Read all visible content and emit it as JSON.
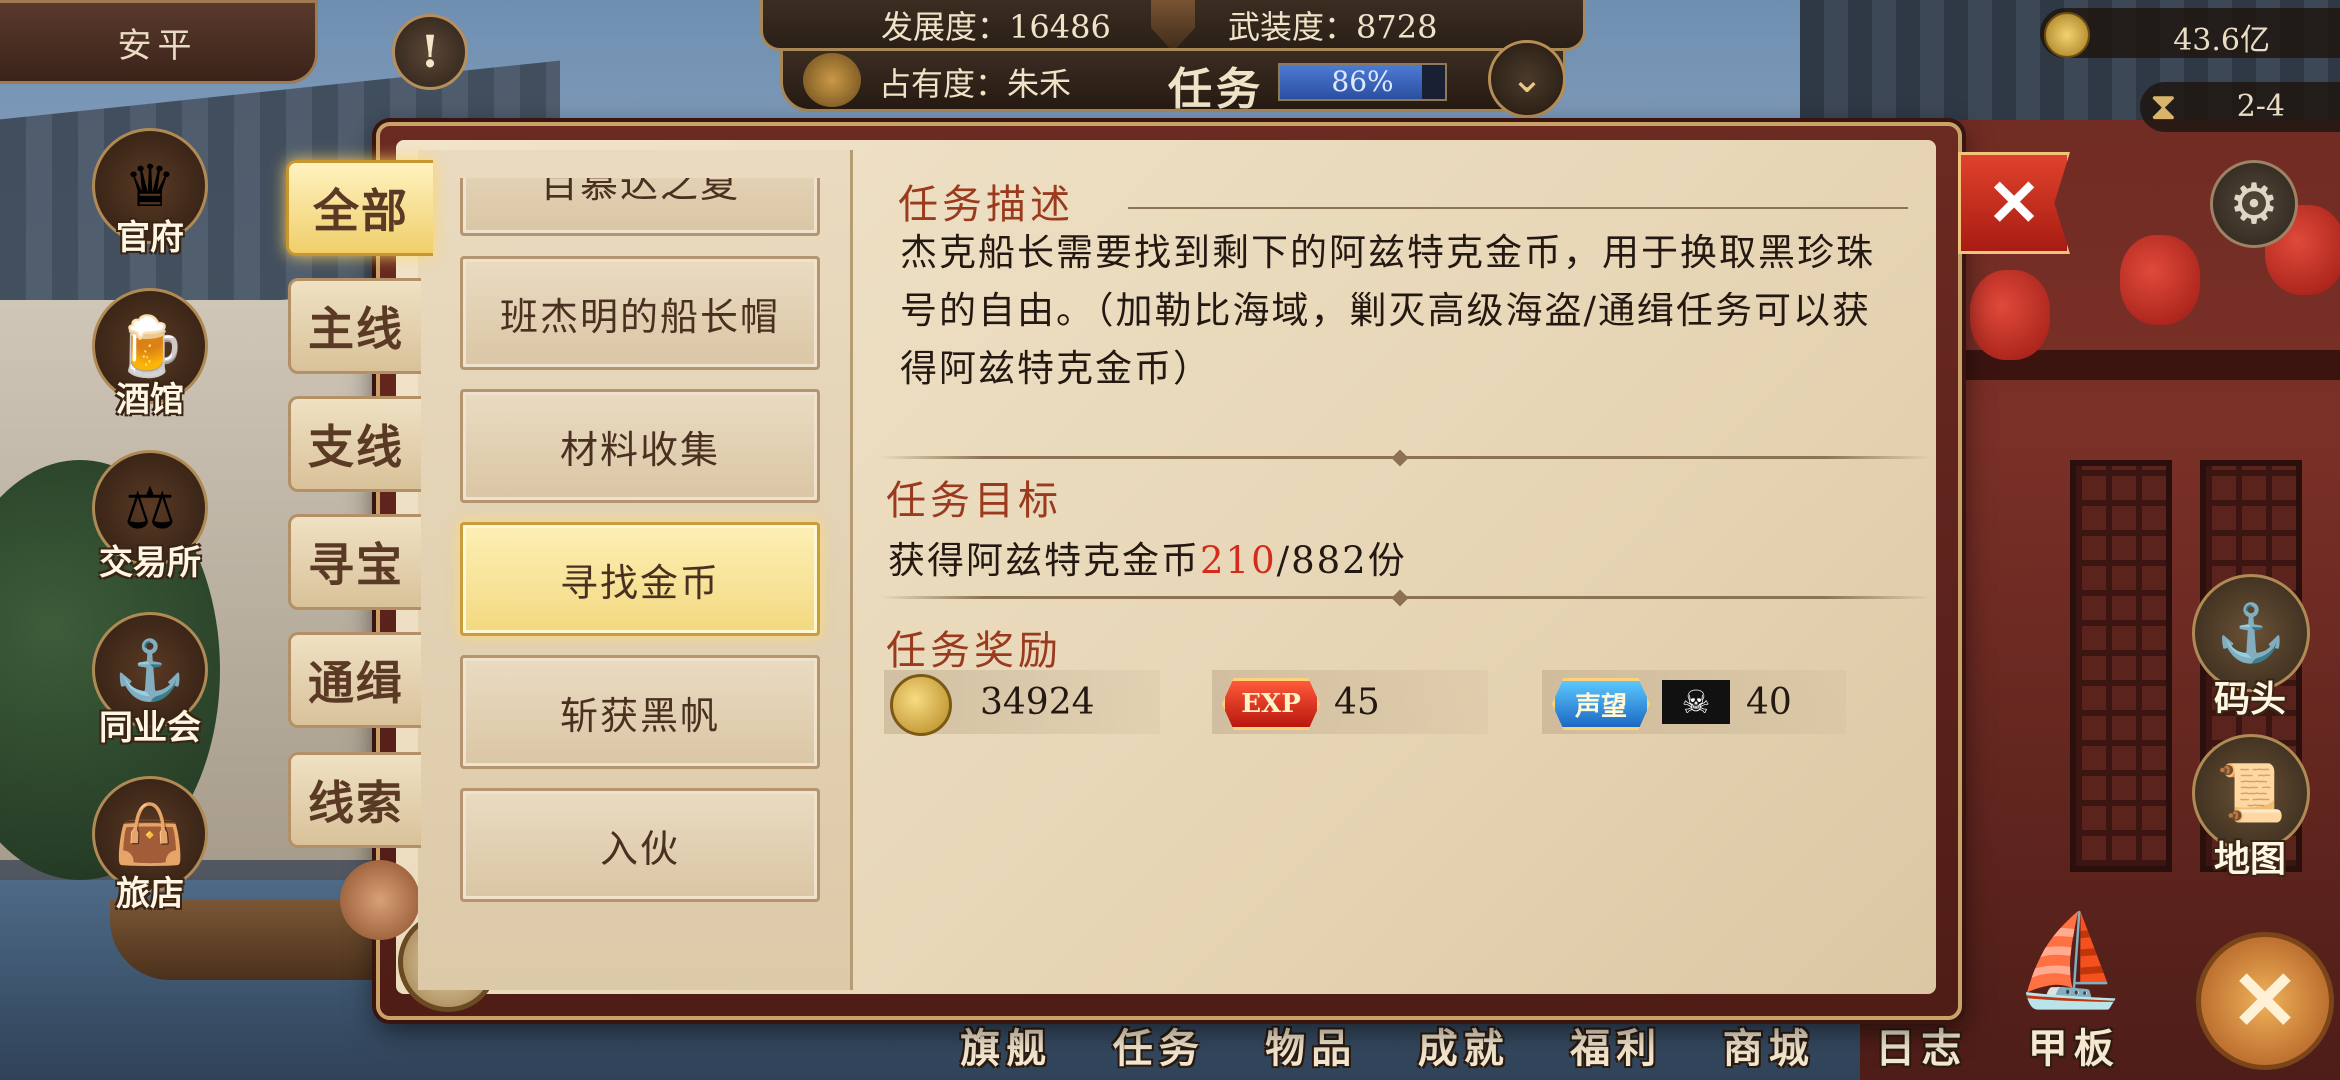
{
  "top_left": {
    "name": "安平",
    "alert_icon": "!"
  },
  "status": {
    "development": "发展度：16486",
    "armament": "武装度：8728",
    "occupancy": "占有度：朱禾",
    "quest_title": "任务",
    "progress_text": "86%",
    "progress_value": 0.86
  },
  "top_right": {
    "gold": "43.6亿",
    "time": "2-4"
  },
  "left_nav": [
    {
      "label": "官府",
      "icon": "crown-icon",
      "glyph": "♛"
    },
    {
      "label": "酒馆",
      "icon": "beer-mug-icon",
      "glyph": "🍺"
    },
    {
      "label": "交易所",
      "icon": "scales-icon",
      "glyph": "⚖"
    },
    {
      "label": "同业会",
      "icon": "anchor-shield-icon",
      "glyph": "⚓"
    },
    {
      "label": "旅店",
      "icon": "bag-icon",
      "glyph": "👜"
    }
  ],
  "right_nav": [
    {
      "label": "码头",
      "icon": "dock-icon",
      "glyph": "⚓"
    },
    {
      "label": "地图",
      "icon": "map-scroll-icon",
      "glyph": "📜"
    }
  ],
  "bottom_menu": [
    "旗舰",
    "任务",
    "物品",
    "成就",
    "福利",
    "商城",
    "日志",
    "甲板"
  ],
  "tabs": [
    "全部",
    "主线",
    "支线",
    "寻宝",
    "通缉",
    "线索"
  ],
  "task_list": [
    "百慕达之夏",
    "班杰明的船长帽",
    "材料收集",
    "寻找金币",
    "斩获黑帆",
    "入伙"
  ],
  "detail": {
    "desc_title": "任务描述",
    "desc": "杰克船长需要找到剩下的阿兹特克金币，用于换取黑珍珠号的自由。（加勒比海域，剿灭高级海盗/通缉任务可以获得阿兹特克金币）",
    "goal_title": "任务目标",
    "goal_prefix": "获得阿兹特克金币",
    "goal_current": "210",
    "goal_suffix": "/882份",
    "reward_title": "任务奖励",
    "rewards": {
      "gold": "34924",
      "exp_label": "EXP",
      "exp": "45",
      "fame_label": "声望",
      "fame": "40"
    }
  },
  "colors": {
    "accent_red": "#d42b1c",
    "title_brown": "#9a3a1e",
    "progress_blue": "#3a64c0"
  }
}
